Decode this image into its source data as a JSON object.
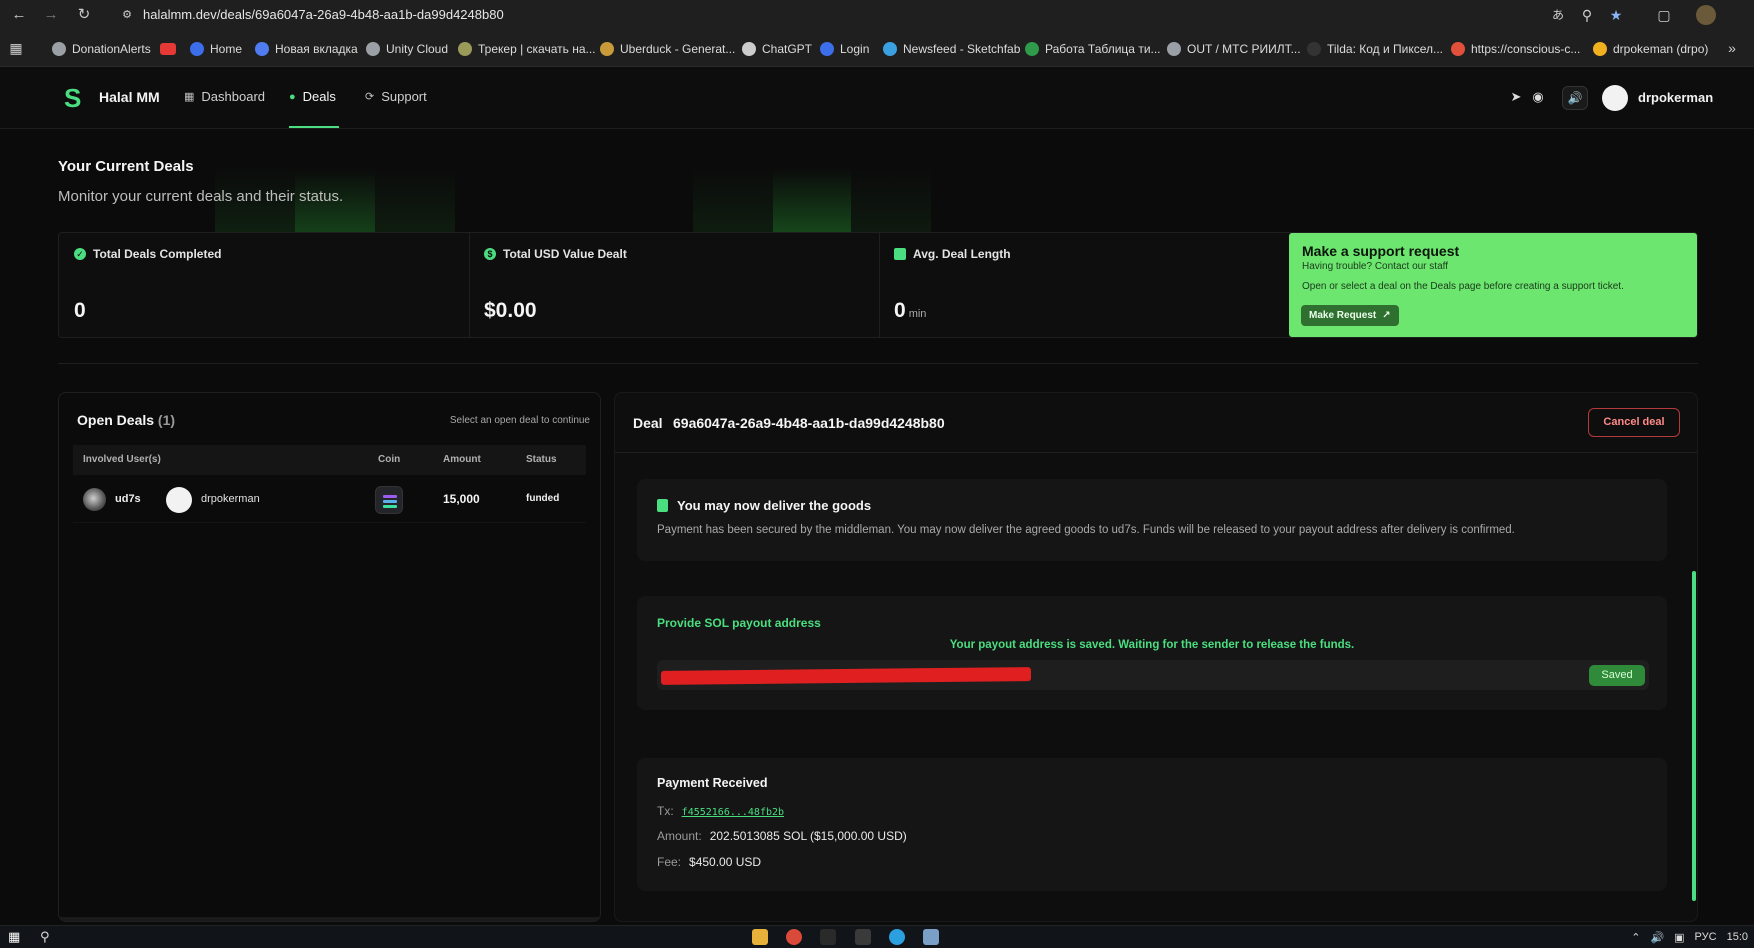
{
  "browser": {
    "url": "halalmm.dev/deals/69a6047a-26a9-4b48-aa1b-da99d4248b80",
    "bookmarks": [
      {
        "label": "DonationAlerts",
        "color": "#9aa0a6"
      },
      {
        "label": "",
        "color": "#e53935"
      },
      {
        "label": "Home",
        "color": "#3b6ee8"
      },
      {
        "label": "Новая вкладка",
        "color": "#4f7cf0"
      },
      {
        "label": "Unity Cloud",
        "color": "#9aa0a6"
      },
      {
        "label": "Трекер | скачать на...",
        "color": "#9a9a5a"
      },
      {
        "label": "Uberduck - Generat...",
        "color": "#c89a3a"
      },
      {
        "label": "ChatGPT",
        "color": "#cccccc"
      },
      {
        "label": "Login",
        "color": "#3b6ee8"
      },
      {
        "label": "Newsfeed - Sketchfab",
        "color": "#3aa0e0"
      },
      {
        "label": "Работа Таблица ти...",
        "color": "#2e9a4a"
      },
      {
        "label": "OUT / МТС РИИЛТ...",
        "color": "#9aa0a6"
      },
      {
        "label": "Tilda: Код и Пиксел...",
        "color": "#333333"
      },
      {
        "label": "https://conscious-c...",
        "color": "#e0503a"
      },
      {
        "label": "drpokeman (drpo)",
        "color": "#f0b020"
      }
    ]
  },
  "header": {
    "brand": "Halal MM",
    "nav": [
      "Dashboard",
      "Deals",
      "Support"
    ],
    "active_nav": "Deals",
    "username": "drpokerman"
  },
  "hero": {
    "title": "Your Current Deals",
    "subtitle": "Monitor your current deals and their status."
  },
  "stats": [
    {
      "label": "Total Deals Completed",
      "value": "0",
      "unit": ""
    },
    {
      "label": "Total USD Value Dealt",
      "value": "$0.00",
      "unit": ""
    },
    {
      "label": "Avg. Deal Length",
      "value": "0",
      "unit": "min"
    }
  ],
  "support": {
    "title": "Make a support request",
    "subtitle": "Having trouble? Contact our staff",
    "description": "Open or select a deal on the Deals page before creating a support ticket.",
    "button": "Make Request",
    "color": "#6ce66f"
  },
  "open_deals": {
    "title": "Open Deals",
    "count": "(1)",
    "hint": "Select an open deal to continue",
    "columns": [
      "Involved User(s)",
      "Coin",
      "Amount",
      "Status"
    ],
    "rows": [
      {
        "user1": "ud7s",
        "user2": "drpokerman",
        "coin": "SOL",
        "amount": "15,000",
        "status": "funded"
      }
    ]
  },
  "deal": {
    "label": "Deal",
    "id": "69a6047a-26a9-4b48-aa1b-da99d4248b80",
    "cancel": "Cancel deal",
    "notice_title": "You may now deliver the goods",
    "notice_body": "Payment has been secured by the middleman. You may now deliver the agreed goods to ud7s. Funds will be released to your payout address after delivery is confirmed.",
    "payout_title": "Provide SOL payout address",
    "payout_status": "Your payout address is saved. Waiting for the sender to release the funds.",
    "payout_address": "",
    "saved_label": "Saved",
    "payment_title": "Payment Received",
    "tx_label": "Tx:",
    "tx_value": "f4552166...48fb2b",
    "amount_label": "Amount:",
    "amount_value": "202.5013085 SOL ($15,000.00 USD)",
    "fee_label": "Fee:",
    "fee_value": "$450.00 USD"
  },
  "taskbar": {
    "lang": "РУС",
    "time": "15:0"
  },
  "colors": {
    "accent": "#4ade80",
    "danger": "#b33a3a",
    "background": "#0b0b0b"
  }
}
